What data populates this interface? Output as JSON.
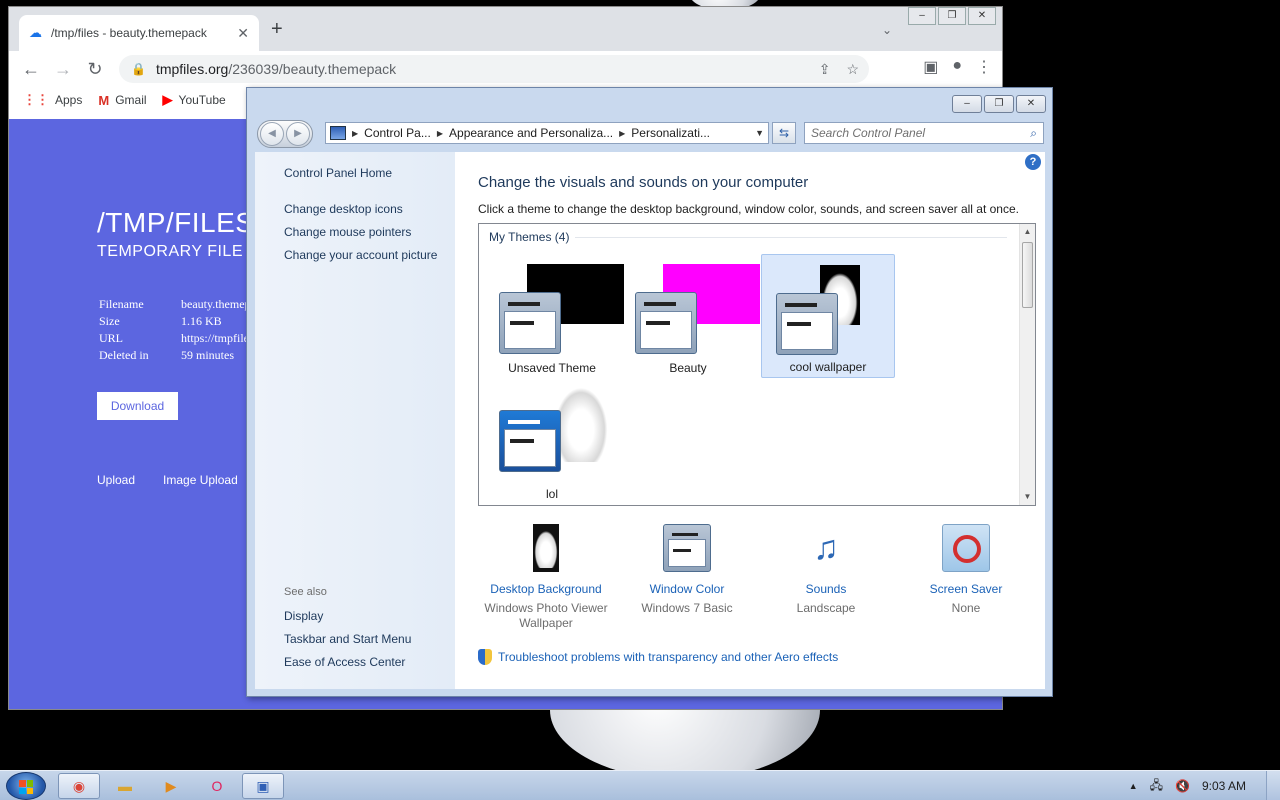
{
  "browser": {
    "tab_title": "/tmp/files - beauty.themepack",
    "tab_close": "✕",
    "new_tab": "+",
    "url_host": "tmpfiles.org",
    "url_path": "/236039/beauty.themepack",
    "bookmarks": [
      {
        "label": "Apps",
        "icon": "apps-grid-icon"
      },
      {
        "label": "Gmail",
        "icon": "gmail-icon"
      },
      {
        "label": "YouTube",
        "icon": "youtube-icon"
      }
    ]
  },
  "tmpfiles": {
    "title": "/TMP/FILES",
    "subtitle": "TEMPORARY FILE H",
    "rows": [
      {
        "key": "Filename",
        "value": "beauty.themep"
      },
      {
        "key": "Size",
        "value": "1.16 KB"
      },
      {
        "key": "URL",
        "value": "https://tmpfile"
      },
      {
        "key": "Deleted in",
        "value": "59 minutes"
      }
    ],
    "download_label": "Download",
    "links": [
      "Upload",
      "Image Upload"
    ],
    "background_color": "#5c66e0"
  },
  "control_panel": {
    "breadcrumb": [
      "Control Pa...",
      "Appearance and Personaliza...",
      "Personalizati..."
    ],
    "search_placeholder": "Search Control Panel",
    "sidebar": {
      "home": "Control Panel Home",
      "links": [
        "Change desktop icons",
        "Change mouse pointers",
        "Change your account picture"
      ],
      "see_also_title": "See also",
      "see_also": [
        "Display",
        "Taskbar and Start Menu",
        "Ease of Access Center"
      ]
    },
    "heading": "Change the visuals and sounds on your computer",
    "description": "Click a theme to change the desktop background, window color, sounds, and screen saver all at once.",
    "group_label": "My Themes (4)",
    "themes": [
      {
        "name": "Unsaved Theme",
        "selected": false
      },
      {
        "name": "Beauty",
        "selected": false
      },
      {
        "name": "cool wallpaper",
        "selected": true
      },
      {
        "name": "lol",
        "selected": false
      }
    ],
    "options": [
      {
        "label": "Desktop Background",
        "sub": "Windows Photo Viewer Wallpaper"
      },
      {
        "label": "Window Color",
        "sub": "Windows 7 Basic"
      },
      {
        "label": "Sounds",
        "sub": "Landscape"
      },
      {
        "label": "Screen Saver",
        "sub": "None"
      }
    ],
    "troubleshoot": "Troubleshoot problems with transparency and other Aero effects"
  },
  "taskbar": {
    "clock": "9:03 AM"
  }
}
